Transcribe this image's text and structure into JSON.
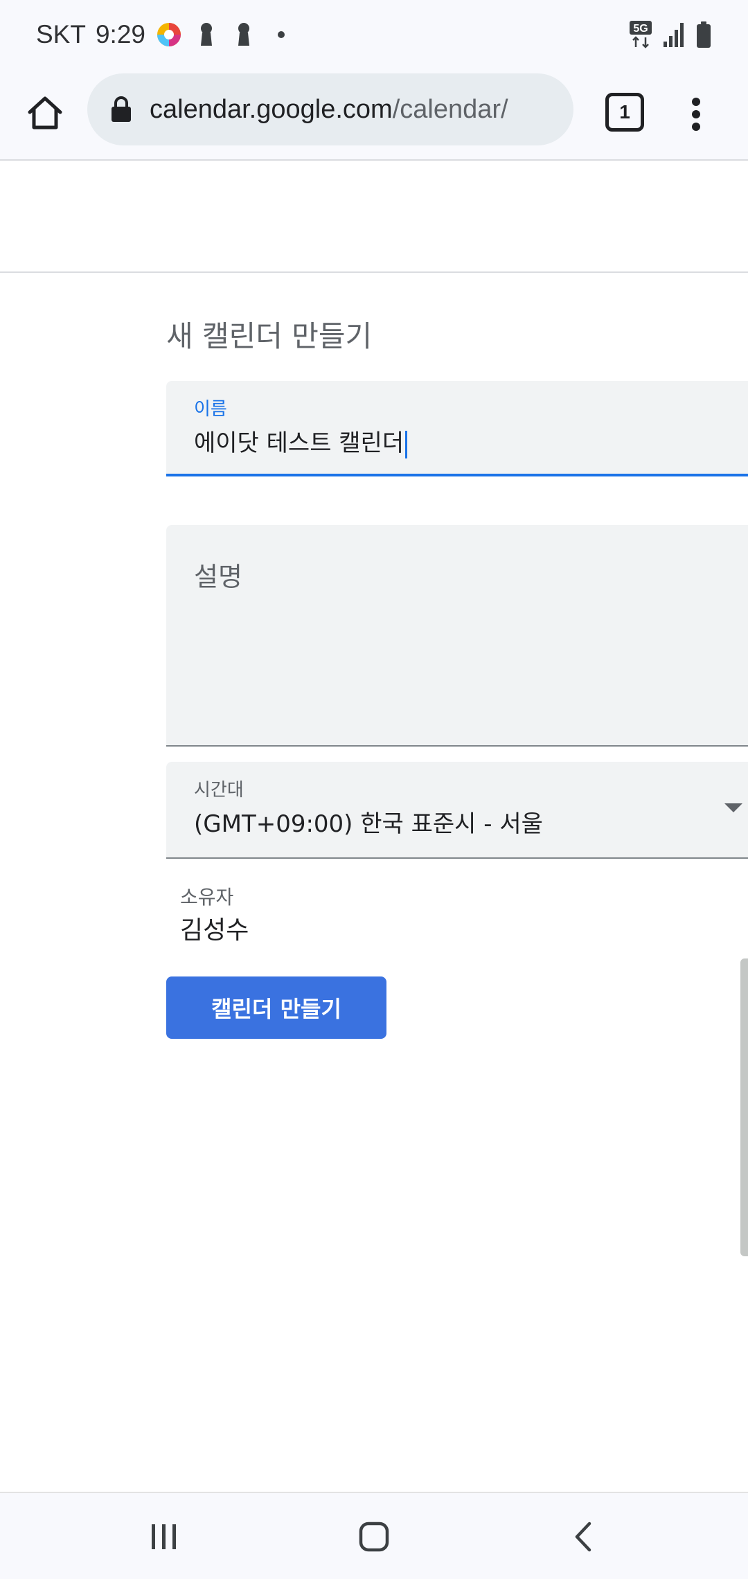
{
  "status_bar": {
    "carrier": "SKT",
    "time": "9:29",
    "network_badge": "5G",
    "icons": [
      "app-icon",
      "key-icon",
      "key-icon",
      "dot-icon",
      "network-5g-icon",
      "signal-icon",
      "battery-icon"
    ]
  },
  "toolbar": {
    "url_domain": "calendar.google.com",
    "url_path": "/calendar/",
    "tab_count": "1",
    "icons": [
      "home-icon",
      "lock-icon",
      "tabs-icon",
      "more-vert-icon"
    ]
  },
  "form": {
    "heading": "새 캘린더 만들기",
    "name_label": "이름",
    "name_value": "에이닷 테스트 캘린더",
    "description_placeholder": "설명",
    "timezone_label": "시간대",
    "timezone_value": "(GMT+09:00) 한국 표준시 - 서울",
    "owner_label": "소유자",
    "owner_value": "김성수",
    "create_button": "캘린더 만들기"
  },
  "nav_bar": {
    "icons": [
      "recent-apps-icon",
      "home-icon",
      "back-icon"
    ]
  },
  "colors": {
    "accent": "#1a73e8",
    "button": "#3a72e0",
    "field_bg": "#f1f3f4"
  }
}
